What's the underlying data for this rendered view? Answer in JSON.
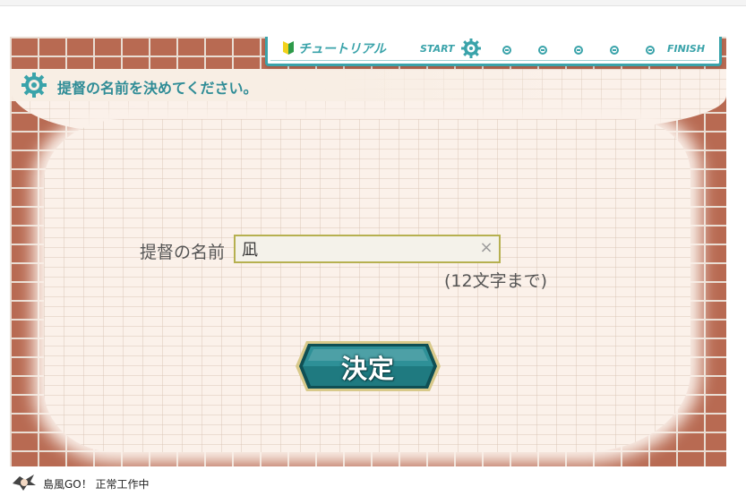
{
  "instruction": {
    "text": "提督の名前を決めてください。"
  },
  "tutorial": {
    "label": "チュートリアル",
    "start_label": "START",
    "finish_label": "FINISH",
    "current_step": 1,
    "total_steps": 6
  },
  "form": {
    "name_label": "提督の名前",
    "name_value": "凪",
    "clear_glyph": "×",
    "limit_note": "(12文字まで)"
  },
  "decide_button": {
    "label": "決定"
  },
  "status_bar": {
    "text": "島風GO！ 正常工作中"
  },
  "colors": {
    "accent_teal": "#3aa3aa",
    "brick": "#b86a52",
    "button_teal": "#1f7a80",
    "button_gold": "#d8c98a"
  }
}
